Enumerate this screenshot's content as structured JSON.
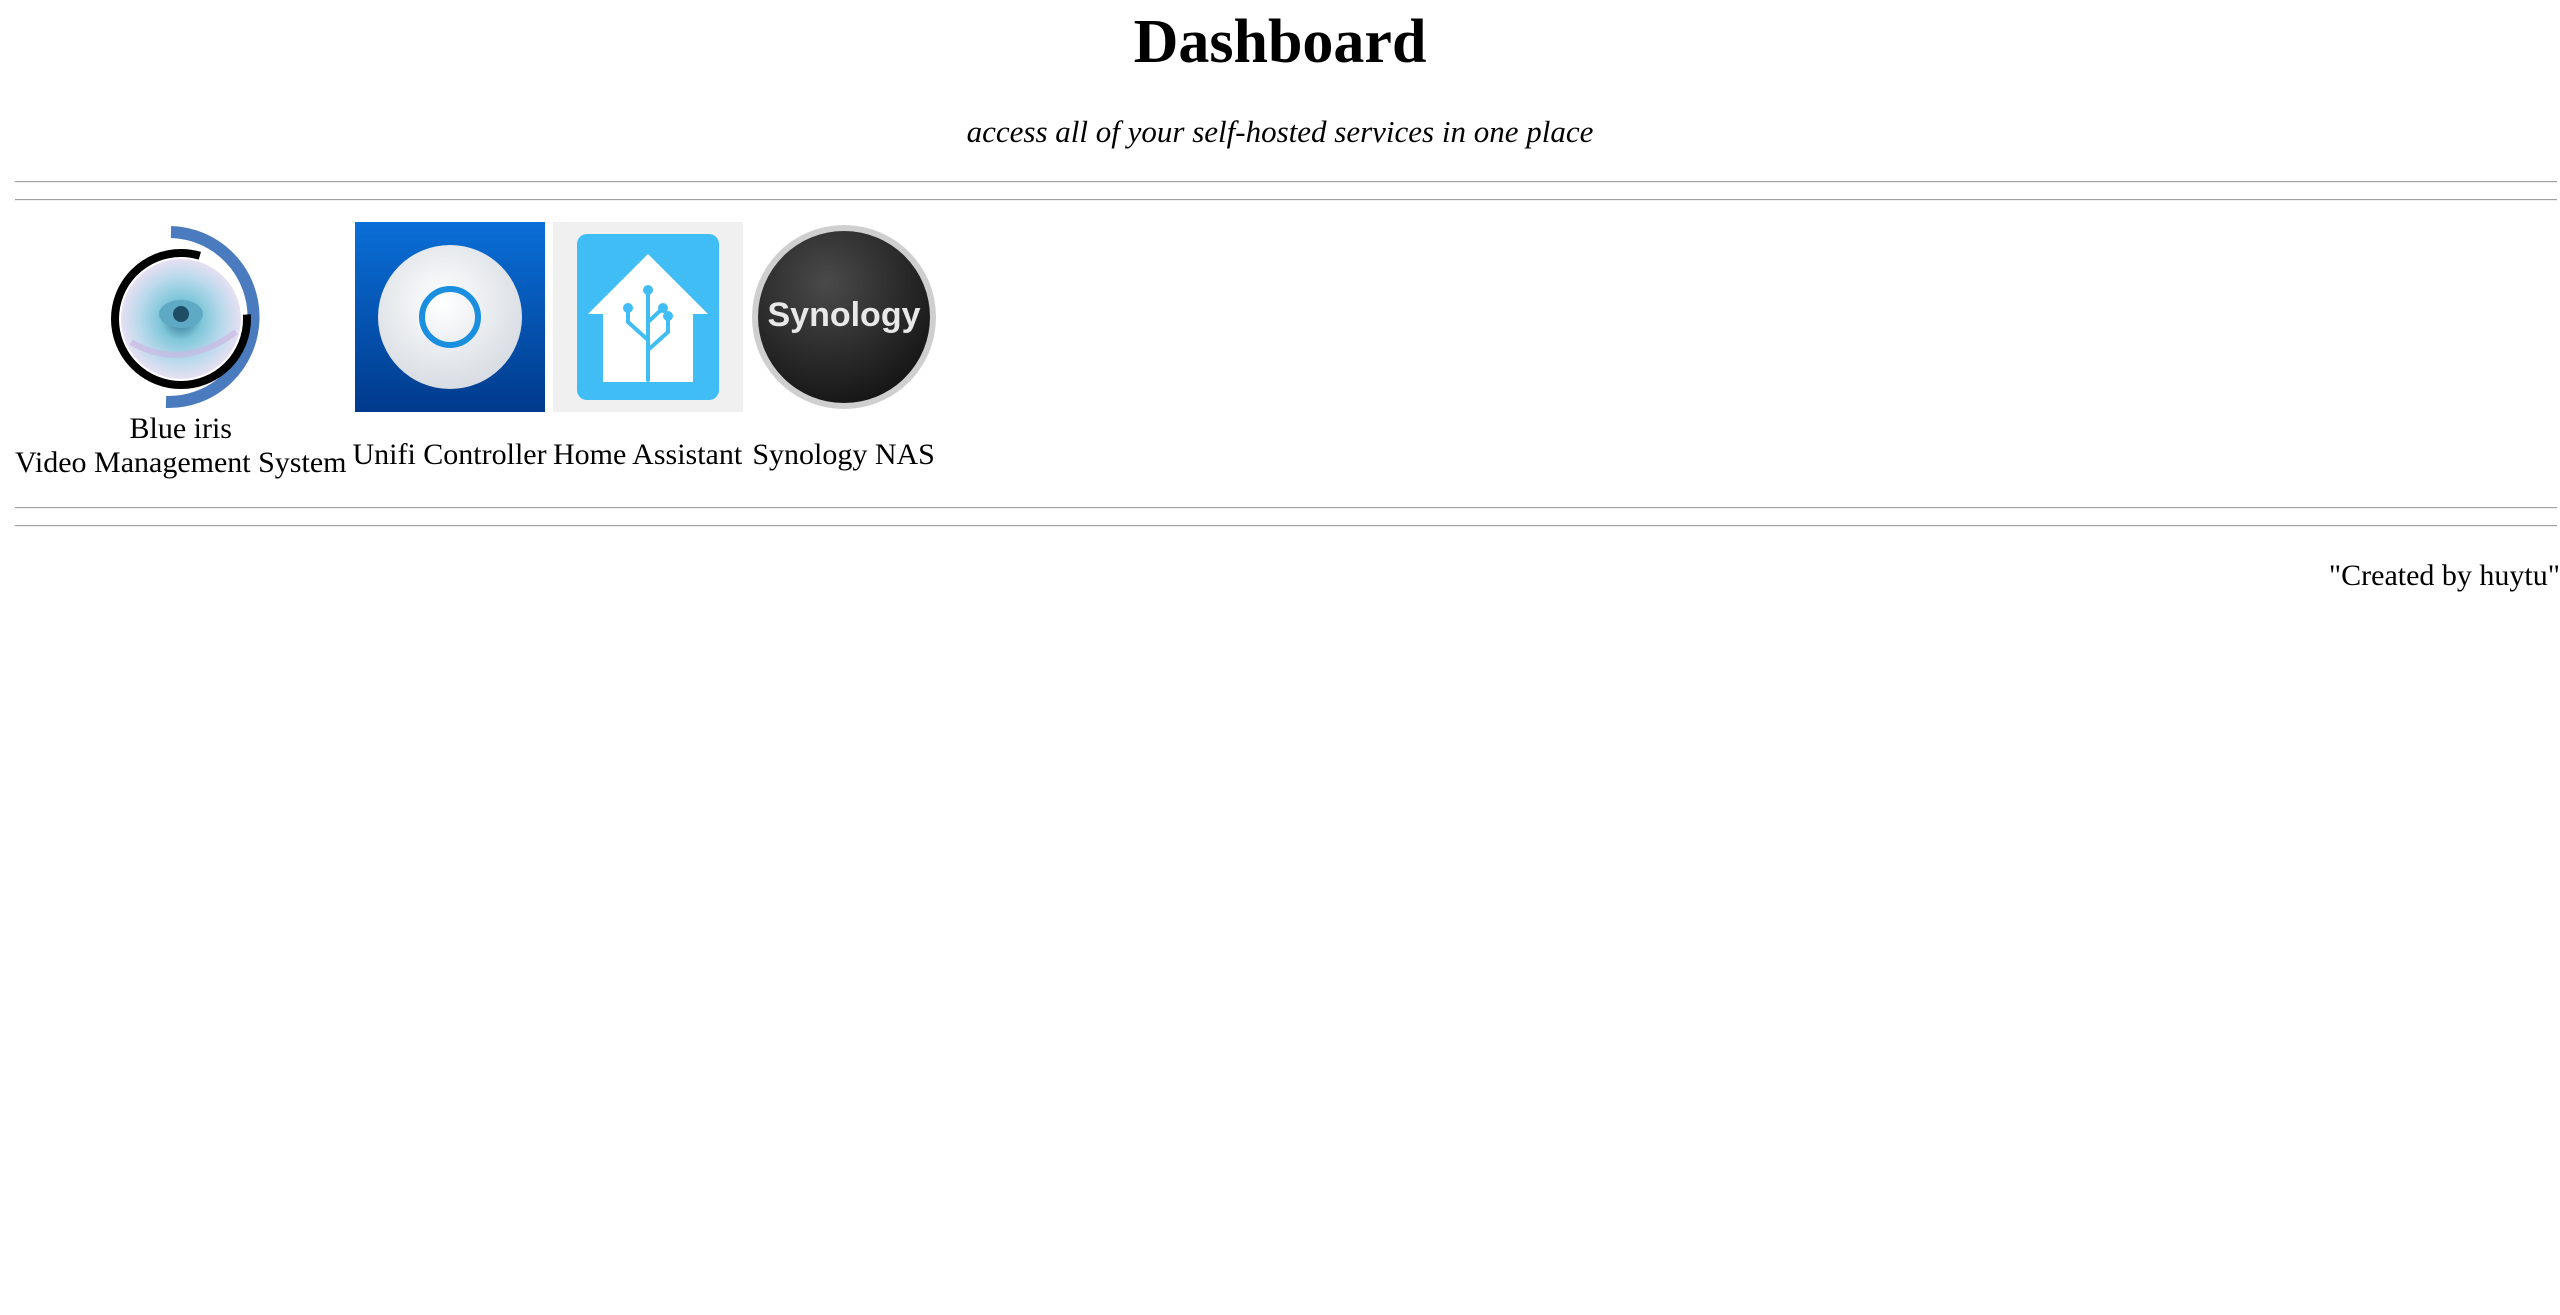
{
  "header": {
    "title": "Dashboard",
    "subtitle": "access all of your self-hosted services in one place"
  },
  "services": [
    {
      "name_line1": "Blue iris",
      "name_line2": "Video Management System",
      "icon": "blue-iris-eye-icon"
    },
    {
      "name": "Unifi Controller",
      "icon": "unifi-access-point-icon"
    },
    {
      "name": "Home Assistant",
      "icon": "home-assistant-house-icon"
    },
    {
      "name": "Synology NAS",
      "icon": "synology-logo-icon",
      "logo_text": "Synology"
    }
  ],
  "footer": {
    "credit": "\"Created by huytu\""
  },
  "colors": {
    "blue_iris_ring": "#4a7bbf",
    "unifi_bg_top": "#0a6fd8",
    "unifi_bg_bottom": "#003a8c",
    "unifi_ring": "#1a8fe0",
    "home_assistant_bg": "#41bdf5",
    "synology_bg": "#2a2a2a",
    "rule": "#a0a0a0"
  }
}
